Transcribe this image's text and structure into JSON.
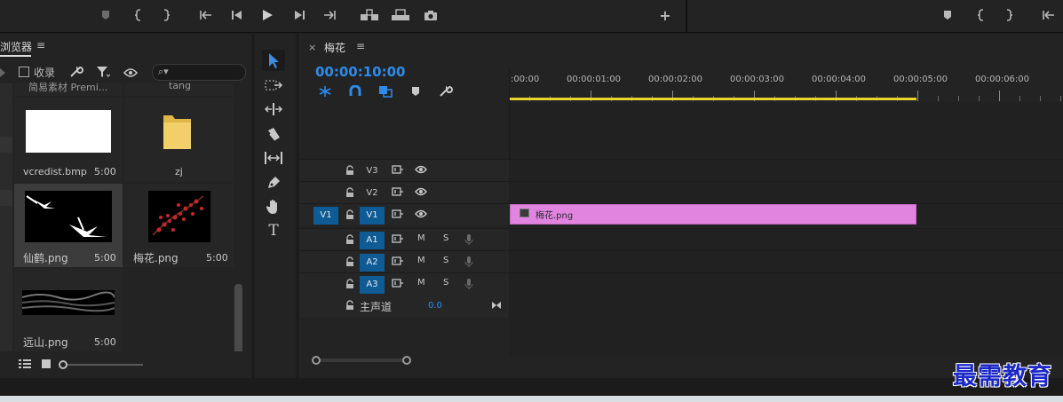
{
  "top_strip": {
    "plus_label": "+",
    "icons": [
      "marker-icon",
      "mark-in-icon",
      "mark-out-icon",
      "go-to-in-icon",
      "step-back-icon",
      "play-icon",
      "step-forward-icon",
      "go-to-out-icon",
      "insert-icon",
      "overwrite-icon",
      "export-frame-icon"
    ],
    "right_icons": [
      "marker-icon",
      "mark-in-icon",
      "mark-out-icon",
      "go-to-in-icon"
    ]
  },
  "project": {
    "tab_label": "浏览器",
    "menu_glyph": "≡",
    "collect_label": "收录",
    "search_glyph": "⌕▾",
    "items": [
      {
        "name": "简易素材 Premi...",
        "duration": ""
      },
      {
        "name": "tang",
        "duration": ""
      },
      {
        "name": "vcredist.bmp",
        "duration": "5:00"
      },
      {
        "name": "zj",
        "duration": ""
      },
      {
        "name": "仙鹤.png",
        "duration": "5:00"
      },
      {
        "name": "梅花.png",
        "duration": "5:00"
      },
      {
        "name": "远山.png",
        "duration": "5:00"
      }
    ]
  },
  "timeline": {
    "close_glyph": "×",
    "sequence_name": "梅花",
    "menu_glyph": "≡",
    "timecode": "00:00:10:00",
    "ruler_labels": [
      ":00:00",
      "00:00:01:00",
      "00:00:02:00",
      "00:00:03:00",
      "00:00:04:00",
      "00:00:05:00",
      "00:00:06:00"
    ],
    "video_tracks": [
      {
        "name": "V3",
        "source": "",
        "targeted": false
      },
      {
        "name": "V2",
        "source": "",
        "targeted": false
      },
      {
        "name": "V1",
        "source": "V1",
        "targeted": true
      }
    ],
    "audio_tracks": [
      {
        "name": "A1",
        "m": "M",
        "s": "S"
      },
      {
        "name": "A2",
        "m": "M",
        "s": "S"
      },
      {
        "name": "A3",
        "m": "M",
        "s": "S"
      }
    ],
    "master": {
      "label": "主声道",
      "value": "0.0"
    },
    "clip": {
      "label": "梅花.png",
      "color": "#e184e0"
    }
  },
  "watermark": "最需教育",
  "colors": {
    "accent": "#2d8ceb",
    "target": "#0e5b95",
    "work_area": "#e8d42a"
  }
}
